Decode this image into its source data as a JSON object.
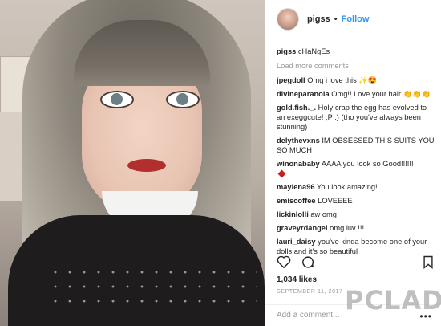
{
  "header": {
    "username": "pigss",
    "separator": "•",
    "follow_label": "Follow"
  },
  "caption": {
    "username": "pigss",
    "text": "cHaNgEs"
  },
  "load_more": "Load more comments",
  "comments": [
    {
      "user": "jpegdoll",
      "text": "Omg i love this ✨😍"
    },
    {
      "user": "divineparanoia",
      "text": "Omg!! Love your hair 👏👏👏"
    },
    {
      "user": "gold.fish._.",
      "text": "Holy crap the egg has evolved to an exeggcute! ;P :) (tho you've always been stunning)"
    },
    {
      "user": "delythevxns",
      "text": "IM OBSESSED THIS SUITS YOU SO MUCH"
    },
    {
      "user": "winonababy",
      "text": "AAAA you look so Good!!!!!!"
    },
    {
      "user": "maylena96",
      "text": "You look amazing!"
    },
    {
      "user": "emiscoffee",
      "text": "LOVEEEE"
    },
    {
      "user": "lickinlolli",
      "text": "aw omg"
    },
    {
      "user": "graveyrdangel",
      "text": "omg luv !!!"
    },
    {
      "user": "lauri_daisy",
      "text": "you've kinda become one of your dolls and it's so beautiful"
    }
  ],
  "likes": "1,034 likes",
  "date": "SEPTEMBER 11, 2017",
  "add_comment_placeholder": "Add a comment...",
  "more_options": "•••",
  "watermark": "PCLADY",
  "colors": {
    "follow": "#3897f0",
    "text": "#262626",
    "muted": "#999999"
  },
  "icons": [
    "heart-icon",
    "comment-icon",
    "bookmark-icon",
    "more-icon"
  ]
}
